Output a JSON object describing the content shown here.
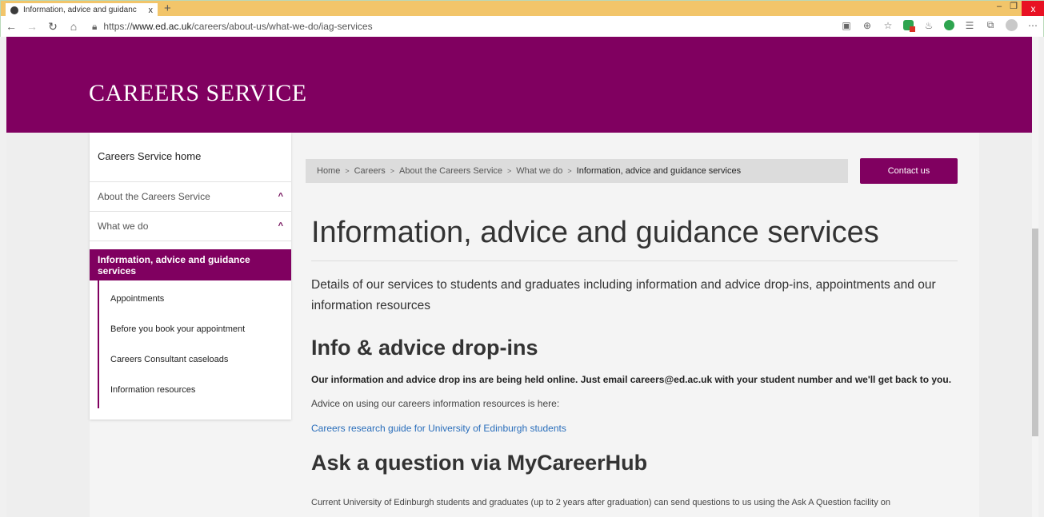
{
  "browser": {
    "tab_title": "Information, advice and guidanc",
    "tab_close": "x",
    "new_tab": "+",
    "url_prefix": "https://",
    "url_domain": "www.ed.ac.uk",
    "url_path": "/careers/about-us/what-we-do/iag-services",
    "window_min": "–",
    "window_max": "❐",
    "window_close": "x"
  },
  "site": {
    "brand": "CAREERS SERVICE"
  },
  "sidebar": {
    "home": "Careers Service home",
    "items": [
      {
        "label": "About the Careers Service",
        "chevron": "^"
      },
      {
        "label": "What we do",
        "chevron": "^"
      }
    ],
    "active": "Information, advice and guidance services",
    "sub_items": [
      "Appointments",
      "Before you book your appointment",
      "Careers Consultant caseloads",
      "Information resources"
    ]
  },
  "breadcrumb": {
    "items": [
      "Home",
      "Careers",
      "About the Careers Service",
      "What we do"
    ],
    "current": "Information, advice and guidance services",
    "separator": ">"
  },
  "contact_button": "Contact us",
  "main": {
    "title": "Information, advice and guidance services",
    "lead": "Details of our services to students and graduates including information and advice drop-ins, appointments and our information resources",
    "section1_title": "Info & advice drop-ins",
    "section1_bold": "Our information and advice drop ins are being held online. Just email careers@ed.ac.uk with your student number and we'll get back to you.",
    "section1_text": "Advice on using our careers information resources is here:",
    "section1_link": "Careers research guide for University of Edinburgh students",
    "section2_title": "Ask a question via MyCareerHub",
    "section2_text": "Current University of Edinburgh students and graduates  (up to 2 years after graduation) can send questions to us using the Ask A Question facility on"
  }
}
